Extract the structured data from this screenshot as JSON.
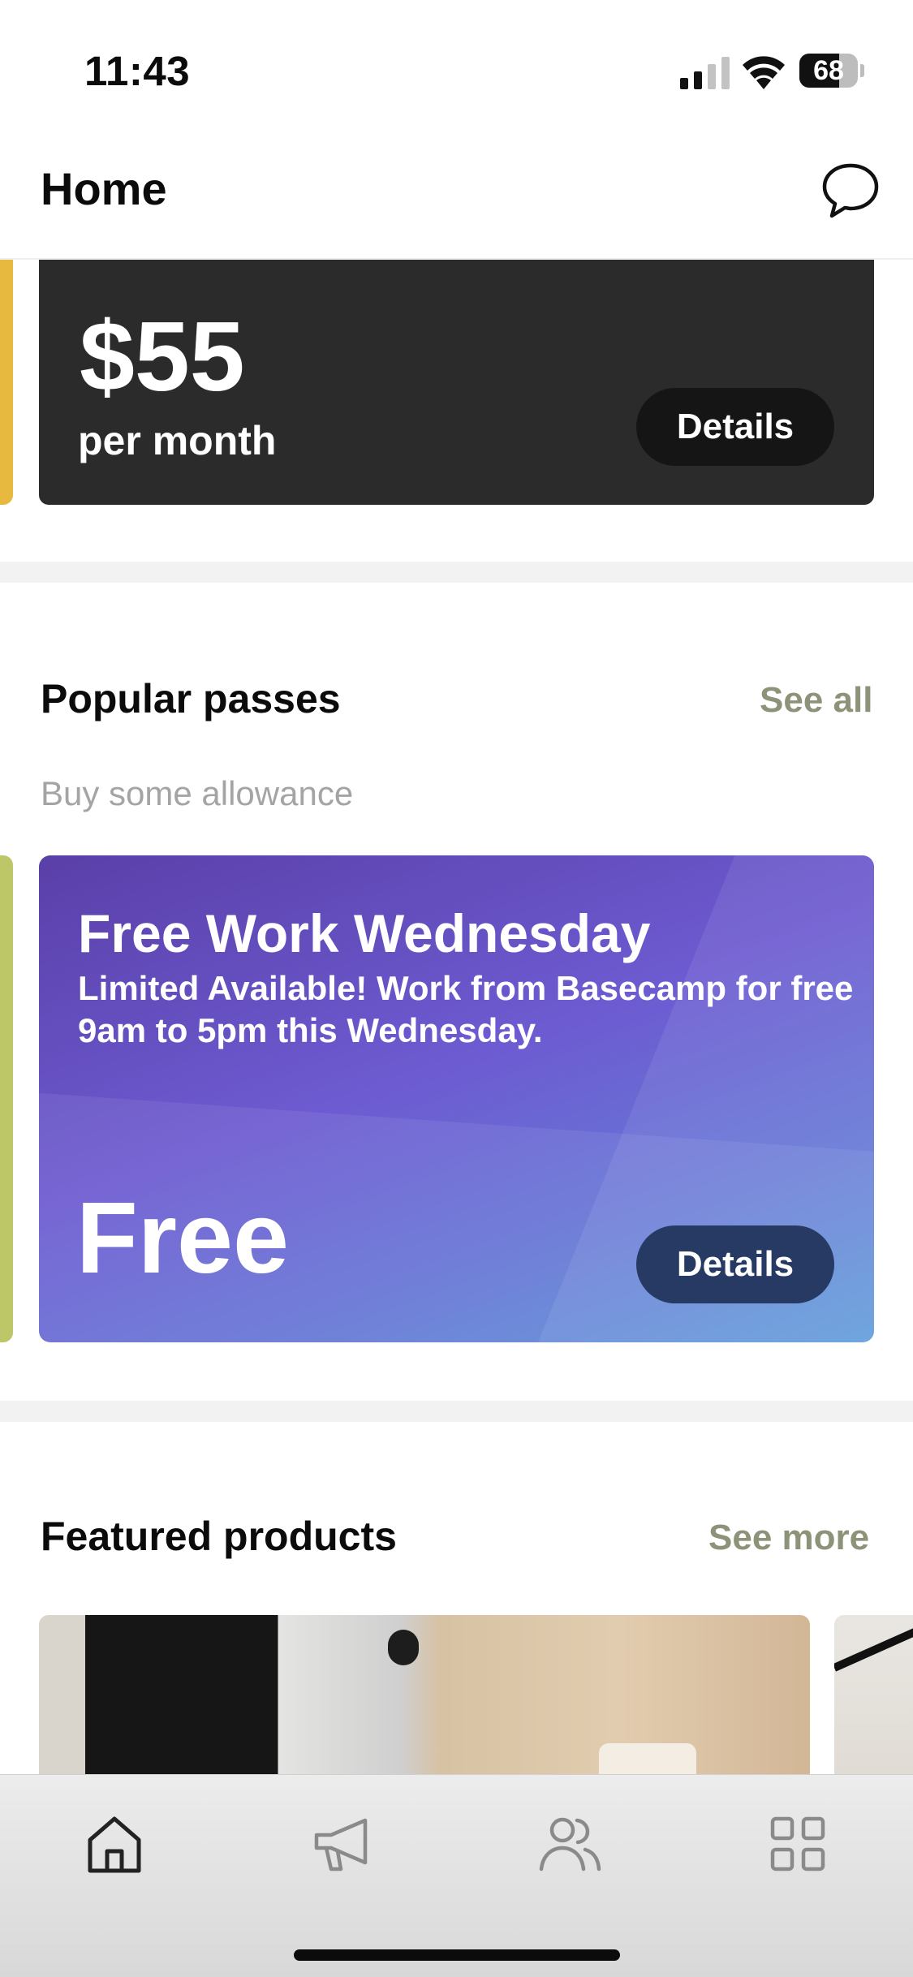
{
  "status_bar": {
    "time": "11:43",
    "battery_percent": "68",
    "battery_level": 0.68
  },
  "header": {
    "title": "Home",
    "chat_icon": "chat-bubble-icon"
  },
  "plan_card": {
    "price": "$55",
    "period": "per month",
    "details_label": "Details"
  },
  "popular_passes": {
    "title": "Popular passes",
    "see_all_label": "See all",
    "subtitle": "Buy some allowance",
    "pass": {
      "title": "Free Work Wednesday",
      "description": "Limited Available! Work from Basecamp for free 9am to 5pm this Wednesday.",
      "price": "Free",
      "details_label": "Details"
    }
  },
  "featured_products": {
    "title": "Featured products",
    "see_more_label": "See more"
  },
  "tab_bar": {
    "items": [
      {
        "icon": "home-icon",
        "active": true
      },
      {
        "icon": "megaphone-icon",
        "active": false
      },
      {
        "icon": "people-icon",
        "active": false
      },
      {
        "icon": "grid-icon",
        "active": false
      }
    ]
  },
  "colors": {
    "accent_link": "#8c9378",
    "plan_card_bg": "#2b2b2b",
    "pass_gradient_start": "#5a3fa8",
    "pass_gradient_end": "#5898da",
    "pass_details_bg": "#263a63"
  }
}
